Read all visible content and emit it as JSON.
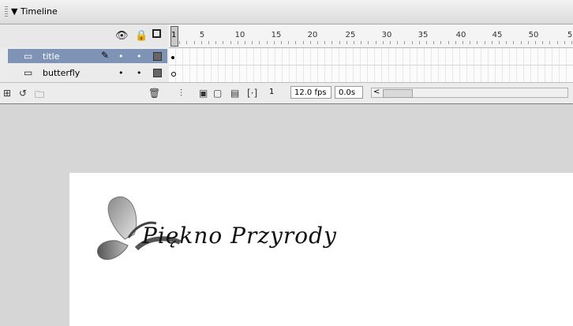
{
  "timeline": {
    "title": "▼ Timeline",
    "frame_numbers": [
      "1",
      "5",
      "10",
      "15",
      "20",
      "25",
      "30",
      "35",
      "40",
      "45",
      "50",
      "5"
    ],
    "current_frame": "1",
    "layers": [
      {
        "name": "title",
        "selected": true
      },
      {
        "name": "butterfly",
        "selected": false
      }
    ],
    "status": {
      "frame": "1",
      "fps": "12.0 fps",
      "time": "0.0s"
    }
  },
  "stage": {
    "text": "Piękno  Przyrody"
  },
  "colors": {
    "selected_layer": "#7e93b6",
    "panel": "#ececec",
    "stage_bg": "#ffffff",
    "workspace": "#d6d6d6"
  },
  "icons": [
    "eye-icon",
    "lock-icon",
    "outline-icon",
    "layer-icon",
    "pencil-icon",
    "trash-icon",
    "onion-skin-icon",
    "scroll-left-icon"
  ]
}
